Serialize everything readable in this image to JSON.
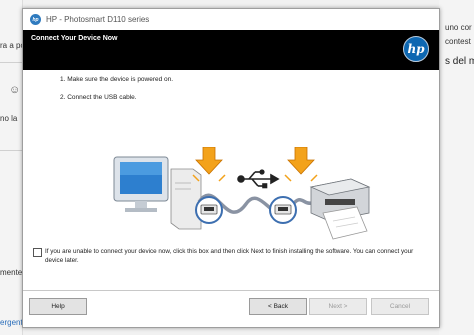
{
  "window": {
    "title": "HP - Photosmart D110 series"
  },
  "header": {
    "title": "Connect Your Device Now",
    "logo_text": "hp"
  },
  "instructions": [
    "1. Make sure the device is powered on.",
    "2. Connect the USB cable."
  ],
  "checkbox": {
    "checked": false,
    "label": "If you are unable to connect your device now, click this box and then click Next to finish installing the software. You can connect your device later."
  },
  "buttons": {
    "help": "Help",
    "back": "< Back",
    "next": "Next >",
    "cancel": "Cancel"
  },
  "background": {
    "left_fragments": [
      "ra a po",
      "no la",
      "mente a",
      "ergente"
    ],
    "right_fragments": [
      "uno cor",
      "contest",
      "s del me"
    ]
  },
  "colors": {
    "header_bg": "#000000",
    "hp_blue": "#0d67b1",
    "arrow_orange": "#f3a21b"
  }
}
